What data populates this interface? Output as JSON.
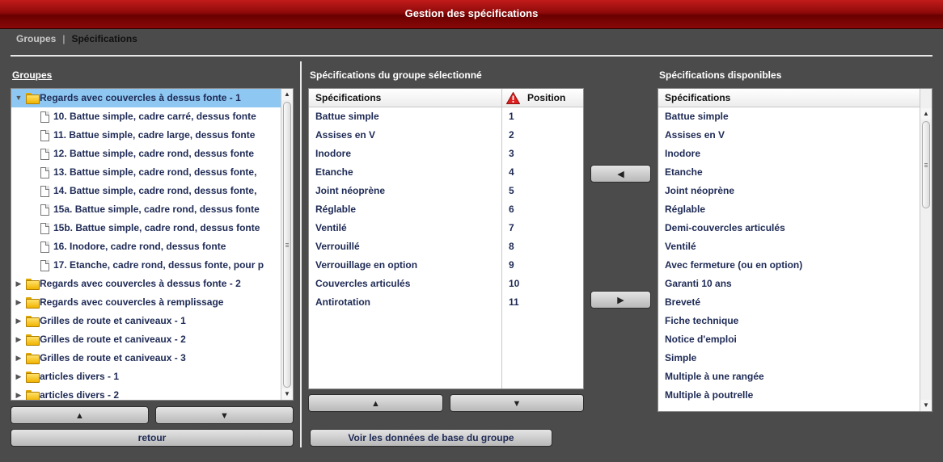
{
  "window": {
    "title": "Gestion des spécifications"
  },
  "breadcrumb": {
    "item1": "Groupes",
    "separator": "|",
    "item2": "Spécifications"
  },
  "groups": {
    "title": "Groupes",
    "tree": [
      {
        "label": "Regards avec couvercles à dessus fonte - 1",
        "type": "folder",
        "expanded": true,
        "selected": true,
        "level": 0
      },
      {
        "label": "10. Battue simple, cadre carré, dessus fonte",
        "type": "doc",
        "level": 1
      },
      {
        "label": "11. Battue simple, cadre large, dessus fonte",
        "type": "doc",
        "level": 1
      },
      {
        "label": "12. Battue simple, cadre rond, dessus fonte",
        "type": "doc",
        "level": 1
      },
      {
        "label": "13. Battue simple, cadre rond, dessus fonte,",
        "type": "doc",
        "level": 1
      },
      {
        "label": "14. Battue simple, cadre rond, dessus fonte,",
        "type": "doc",
        "level": 1
      },
      {
        "label": "15a. Battue simple, cadre rond, dessus fonte",
        "type": "doc",
        "level": 1
      },
      {
        "label": "15b. Battue simple, cadre rond, dessus fonte",
        "type": "doc",
        "level": 1
      },
      {
        "label": "16. Inodore, cadre rond, dessus fonte",
        "type": "doc",
        "level": 1
      },
      {
        "label": "17. Etanche, cadre rond, dessus fonte, pour p",
        "type": "doc",
        "level": 1
      },
      {
        "label": "Regards avec couvercles à dessus fonte - 2",
        "type": "folder",
        "expanded": false,
        "level": 0
      },
      {
        "label": "Regards avec couvercles à remplissage",
        "type": "folder",
        "expanded": false,
        "level": 0
      },
      {
        "label": "Grilles de route et caniveaux - 1",
        "type": "folder",
        "expanded": false,
        "level": 0
      },
      {
        "label": "Grilles de route et caniveaux - 2",
        "type": "folder",
        "expanded": false,
        "level": 0
      },
      {
        "label": "Grilles de route et caniveaux - 3",
        "type": "folder",
        "expanded": false,
        "level": 0
      },
      {
        "label": "articles divers - 1",
        "type": "folder",
        "expanded": false,
        "level": 0
      },
      {
        "label": "articles divers - 2",
        "type": "folder",
        "expanded": false,
        "level": 0
      }
    ],
    "up_glyph": "▲",
    "down_glyph": "▼",
    "back_label": "retour"
  },
  "selected_specs": {
    "title": "Spécifications du groupe sélectionné",
    "col_spec": "Spécifications",
    "col_pos": "Position",
    "rows": [
      {
        "name": "Battue simple",
        "pos": "1"
      },
      {
        "name": "Assises en V",
        "pos": "2"
      },
      {
        "name": "Inodore",
        "pos": "3"
      },
      {
        "name": "Etanche",
        "pos": "4"
      },
      {
        "name": "Joint néoprène",
        "pos": "5"
      },
      {
        "name": "Réglable",
        "pos": "6"
      },
      {
        "name": "Ventilé",
        "pos": "7"
      },
      {
        "name": "Verrouillé",
        "pos": "8"
      },
      {
        "name": "Verrouillage en option",
        "pos": "9"
      },
      {
        "name": "Couvercles articulés",
        "pos": "10"
      },
      {
        "name": "Antirotation",
        "pos": "11"
      }
    ],
    "up_glyph": "▲",
    "down_glyph": "▼",
    "base_data_label": "Voir les données de base du groupe"
  },
  "transfer": {
    "left_glyph": "◀",
    "right_glyph": "▶"
  },
  "available_specs": {
    "title": "Spécifications disponibles",
    "col_spec": "Spécifications",
    "rows": [
      "Battue simple",
      "Assises en V",
      "Inodore",
      "Etanche",
      "Joint néoprène",
      "Réglable",
      "Demi-couvercles articulés",
      "Ventilé",
      "Avec fermeture (ou en option)",
      "Garanti 10 ans",
      "Breveté",
      "Fiche technique",
      "Notice d'emploi",
      "Simple",
      "Multiple à une rangée",
      "Multiple à poutrelle"
    ]
  },
  "colors": {
    "title_red": "#a00000",
    "selection_blue": "#8ec8f2",
    "text_navy": "#1e2a55",
    "background": "#4b4b4b"
  }
}
